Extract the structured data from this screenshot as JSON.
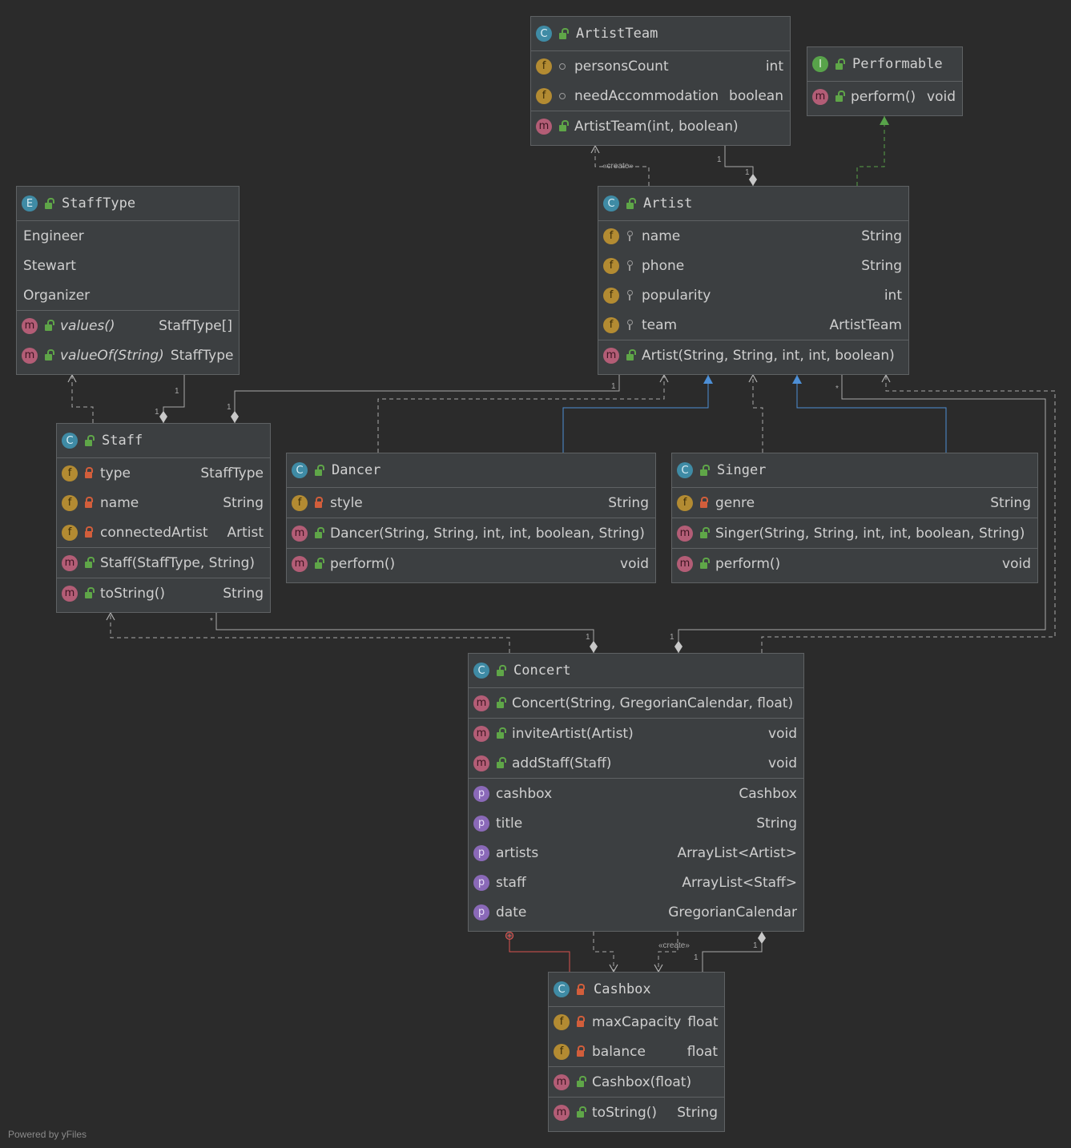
{
  "classes": {
    "artist_team": {
      "name": "ArtistTeam",
      "kind": "C",
      "fields": [
        {
          "name": "personsCount",
          "type": "int"
        },
        {
          "name": "needAccommodation",
          "type": "boolean"
        }
      ],
      "methods": [
        {
          "name": "ArtistTeam(int, boolean)",
          "type": ""
        }
      ]
    },
    "performable": {
      "name": "Performable",
      "kind": "I",
      "methods": [
        {
          "name": "perform()",
          "type": "void"
        }
      ]
    },
    "staff_type": {
      "name": "StaffType",
      "kind": "E",
      "constants": [
        "Engineer",
        "Stewart",
        "Organizer"
      ],
      "methods": [
        {
          "name": "values()",
          "type": "StaffType[]"
        },
        {
          "name": "valueOf(String)",
          "type": "StaffType"
        }
      ]
    },
    "artist": {
      "name": "Artist",
      "kind": "C",
      "fields": [
        {
          "name": "name",
          "type": "String"
        },
        {
          "name": "phone",
          "type": "String"
        },
        {
          "name": "popularity",
          "type": "int"
        },
        {
          "name": "team",
          "type": "ArtistTeam"
        }
      ],
      "methods": [
        {
          "name": "Artist(String, String, int, int, boolean)",
          "type": ""
        }
      ]
    },
    "staff": {
      "name": "Staff",
      "kind": "C",
      "fields": [
        {
          "name": "type",
          "type": "StaffType"
        },
        {
          "name": "name",
          "type": "String"
        },
        {
          "name": "connectedArtist",
          "type": "Artist"
        }
      ],
      "constructors": [
        {
          "name": "Staff(StaffType, String)",
          "type": ""
        }
      ],
      "methods": [
        {
          "name": "toString()",
          "type": "String"
        }
      ]
    },
    "dancer": {
      "name": "Dancer",
      "kind": "C",
      "fields": [
        {
          "name": "style",
          "type": "String"
        }
      ],
      "constructors": [
        {
          "name": "Dancer(String, String, int, int, boolean, String)",
          "type": ""
        }
      ],
      "methods": [
        {
          "name": "perform()",
          "type": "void"
        }
      ]
    },
    "singer": {
      "name": "Singer",
      "kind": "C",
      "fields": [
        {
          "name": "genre",
          "type": "String"
        }
      ],
      "constructors": [
        {
          "name": "Singer(String, String, int, int, boolean, String)",
          "type": ""
        }
      ],
      "methods": [
        {
          "name": "perform()",
          "type": "void"
        }
      ]
    },
    "concert": {
      "name": "Concert",
      "kind": "C",
      "methods": [
        {
          "name": "Concert(String, GregorianCalendar, float)",
          "type": ""
        },
        {
          "name": "inviteArtist(Artist)",
          "type": "void"
        },
        {
          "name": "addStaff(Staff)",
          "type": "void"
        }
      ],
      "properties": [
        {
          "name": "cashbox",
          "type": "Cashbox"
        },
        {
          "name": "title",
          "type": "String"
        },
        {
          "name": "artists",
          "type": "ArrayList<Artist>"
        },
        {
          "name": "staff",
          "type": "ArrayList<Staff>"
        },
        {
          "name": "date",
          "type": "GregorianCalendar"
        }
      ]
    },
    "cashbox": {
      "name": "Cashbox",
      "kind": "C",
      "fields": [
        {
          "name": "maxCapacity",
          "type": "float"
        },
        {
          "name": "balance",
          "type": "float"
        }
      ],
      "constructors": [
        {
          "name": "Cashbox(float)",
          "type": ""
        }
      ],
      "methods": [
        {
          "name": "toString()",
          "type": "String"
        }
      ]
    }
  },
  "edge_labels": {
    "create": "«create»",
    "one": "1",
    "many": "*"
  },
  "footer": "Powered by yFiles",
  "colors": {
    "background": "#2b2b2b",
    "box": "#3c3f41",
    "border": "#5f6264",
    "edge": "#a9a9a9",
    "inherit": "#4d8fd6",
    "implements": "#58a34a",
    "inner": "#d9534f"
  }
}
